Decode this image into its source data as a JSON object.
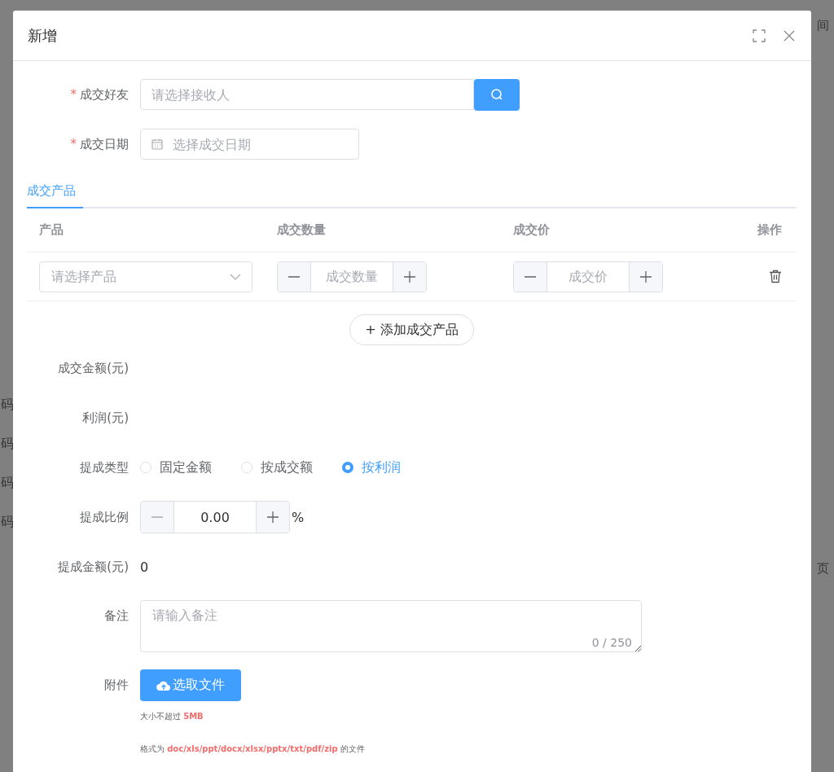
{
  "backdrop": {
    "left_fragments": [
      "码",
      "码",
      "码",
      "码"
    ],
    "right_fragments": [
      "间",
      "页"
    ]
  },
  "dialog": {
    "title": "新增"
  },
  "friend": {
    "label": "成交好友",
    "required_mark": "*",
    "placeholder": "请选择接收人"
  },
  "date": {
    "label": "成交日期",
    "required_mark": "*",
    "placeholder": "选择成交日期"
  },
  "tabs": [
    {
      "label": "成交产品",
      "selected": true
    }
  ],
  "products": {
    "columns": [
      "产品",
      "成交数量",
      "成交价",
      "操作"
    ],
    "rows": [
      {
        "product_placeholder": "请选择产品",
        "quantity_placeholder": "成交数量",
        "price_placeholder": "成交价"
      }
    ],
    "add_button": "+ 添加成交产品"
  },
  "amount": {
    "label": "成交金额(元)"
  },
  "profit": {
    "label": "利润(元)"
  },
  "commission_type": {
    "label": "提成类型",
    "options": [
      {
        "label": "固定金额",
        "selected": false
      },
      {
        "label": "按成交额",
        "selected": false
      },
      {
        "label": "按利润",
        "selected": true
      }
    ]
  },
  "commission_rate": {
    "label": "提成比例",
    "value": "0.00",
    "unit": "%"
  },
  "commission_amount": {
    "label": "提成金额(元)",
    "value": "0"
  },
  "remark": {
    "label": "备注",
    "placeholder": "请输入备注",
    "counter": "0 / 250"
  },
  "attachment": {
    "label": "附件",
    "button": "选取文件",
    "size_hint": "大小不超过 **5MB**",
    "format_hint": "格式为 **doc/xls/ppt/docx/xlsx/pptx/txt/pdf/zip** 的文件"
  }
}
